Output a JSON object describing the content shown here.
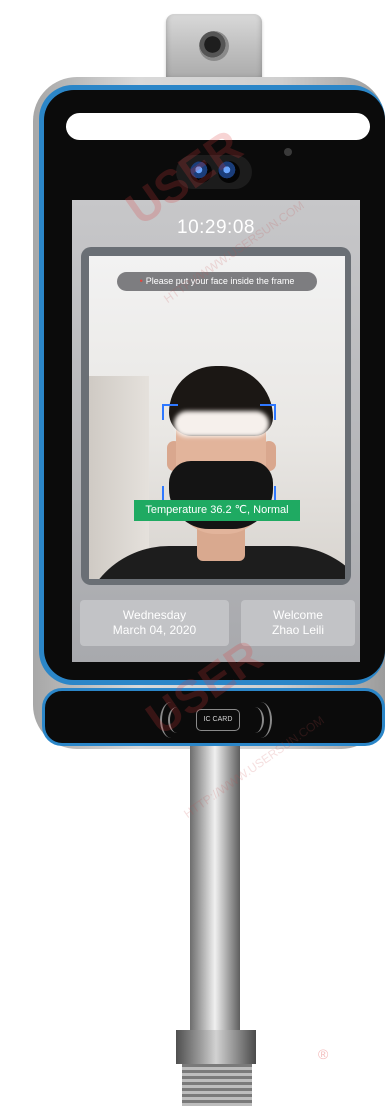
{
  "screen": {
    "time": "10:29:08",
    "prompt": "Please put your face inside the frame",
    "temperature": "Temperature 36.2 ℃, Normal",
    "day": "Wednesday",
    "date": "March 04, 2020",
    "welcome": "Welcome",
    "name": "Zhao Leili"
  },
  "reader": {
    "card_label": "IC CARD"
  },
  "watermark": {
    "brand": "USER",
    "url": "HTTP://WWW.USERSUN.COM",
    "mark": "®"
  },
  "colors": {
    "accent_border": "#2b86c8",
    "status_ok": "#1faa62",
    "detect_frame": "#2f78ff"
  }
}
